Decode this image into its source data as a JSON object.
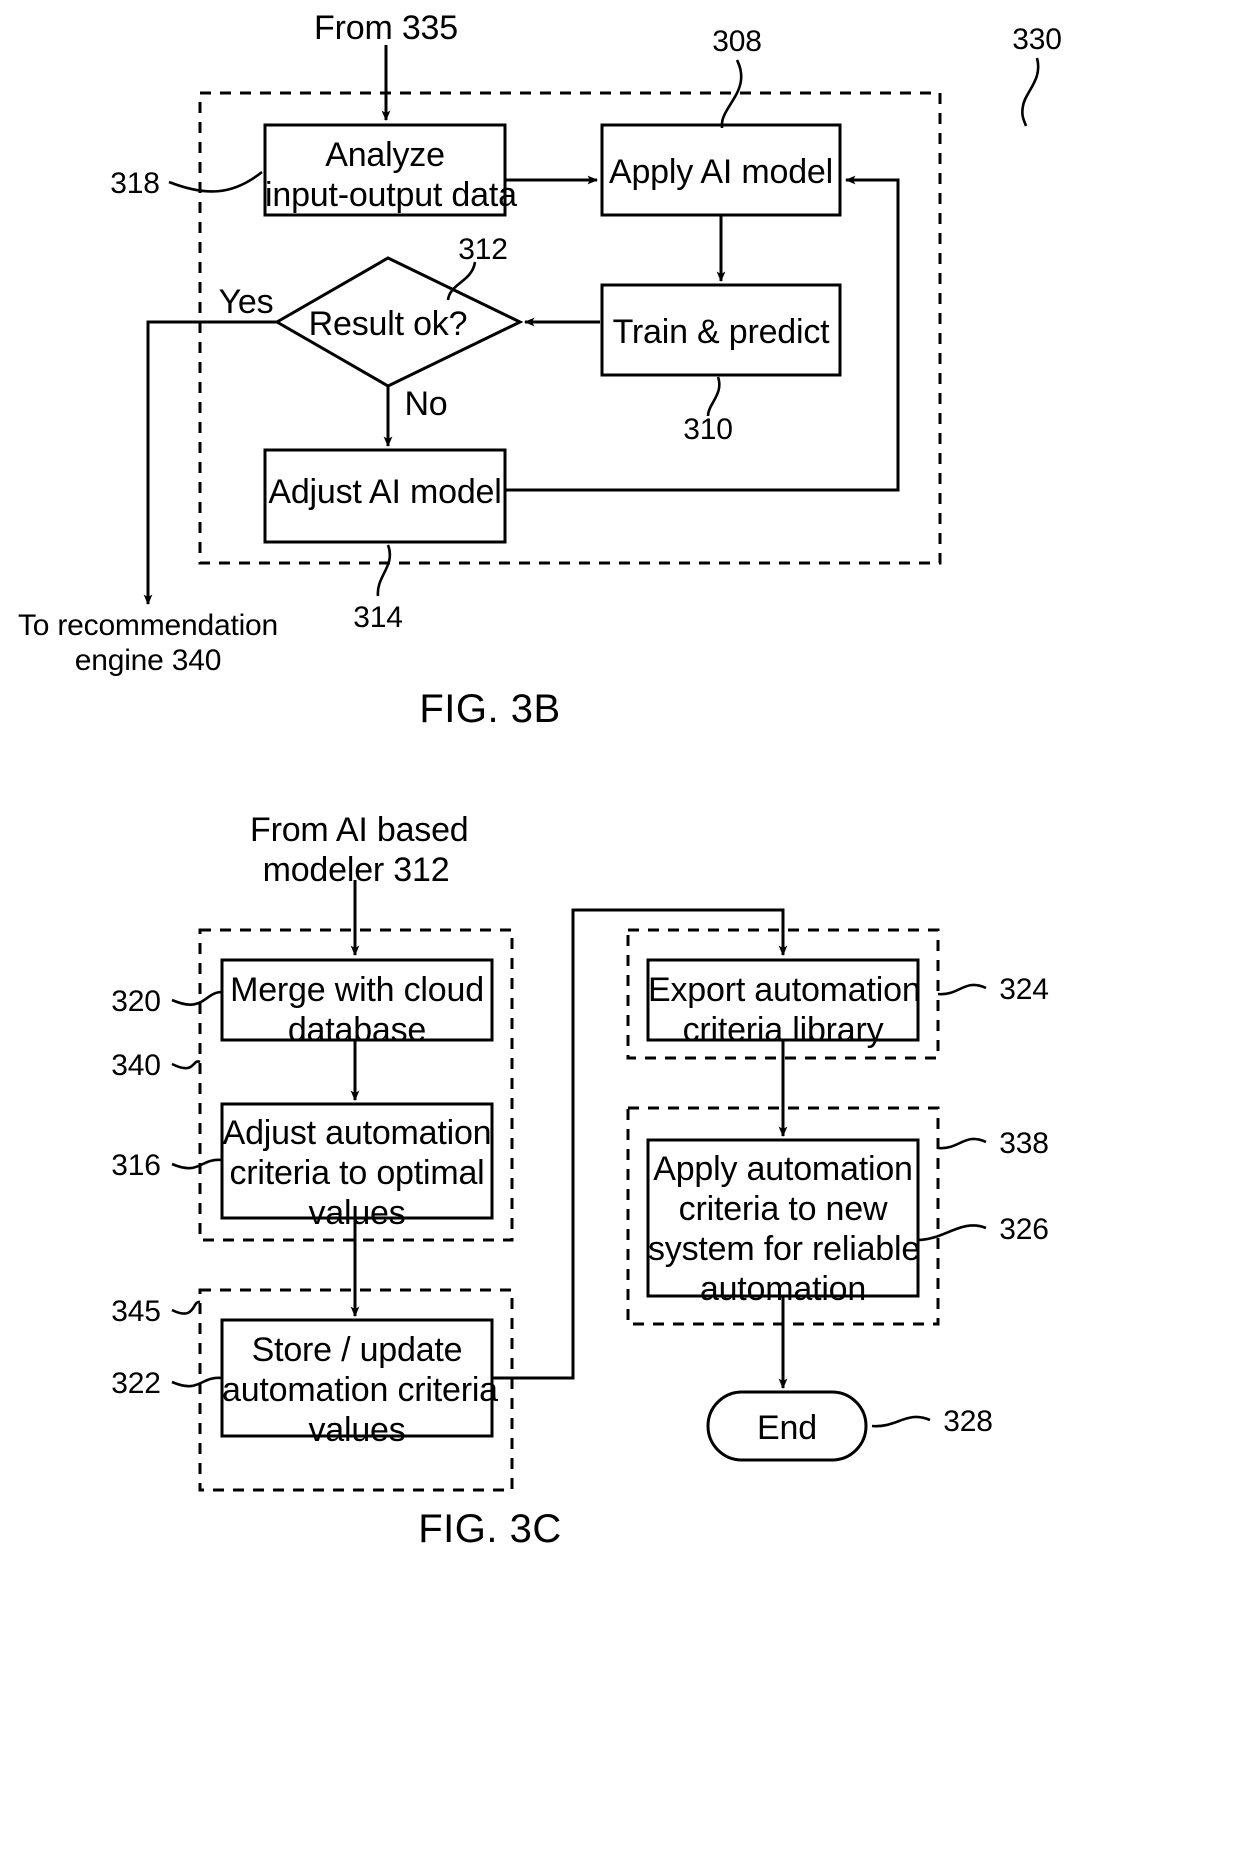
{
  "figures": [
    {
      "id": "fig3b",
      "caption": "FIG. 3B",
      "entry_label": "From 335",
      "exit_label": "To recommendation\nengine 340",
      "group_ref": "330",
      "boxes": [
        {
          "id": "analyze",
          "text": "Analyze\ninput-output data",
          "ref": "318"
        },
        {
          "id": "apply-ai",
          "text": "Apply AI model",
          "ref": "308"
        },
        {
          "id": "train-predict",
          "text": "Train & predict",
          "ref": "310"
        },
        {
          "id": "decision",
          "text": "Result ok?",
          "ref": "312"
        },
        {
          "id": "adjust-ai",
          "text": "Adjust AI model",
          "ref": "314"
        }
      ],
      "edge_labels": {
        "yes": "Yes",
        "no": "No"
      }
    },
    {
      "id": "fig3c",
      "caption": "FIG. 3C",
      "entry_label": "From AI based\nmodeler 312",
      "boxes": [
        {
          "id": "merge-cloud",
          "text": "Merge with cloud\ndatabase",
          "ref": "320"
        },
        {
          "id": "adjust-criteria",
          "text": "Adjust automation\ncriteria to optimal\nvalues",
          "ref": "316"
        },
        {
          "id": "store-update",
          "text": "Store / update\nautomation criteria\nvalues",
          "ref": "322"
        },
        {
          "id": "export-library",
          "text": "Export automation\ncriteria library",
          "ref": "324"
        },
        {
          "id": "apply-new-system",
          "text": "Apply automation\ncriteria to new\nsystem for reliable\nautomation",
          "ref": "326"
        },
        {
          "id": "end",
          "text": "End",
          "ref": "328"
        }
      ],
      "group_refs": {
        "recommendation_engine": "340",
        "storage": "345",
        "deployment": "338"
      }
    }
  ],
  "colors": {
    "stroke": "#000000",
    "background": "#ffffff"
  }
}
